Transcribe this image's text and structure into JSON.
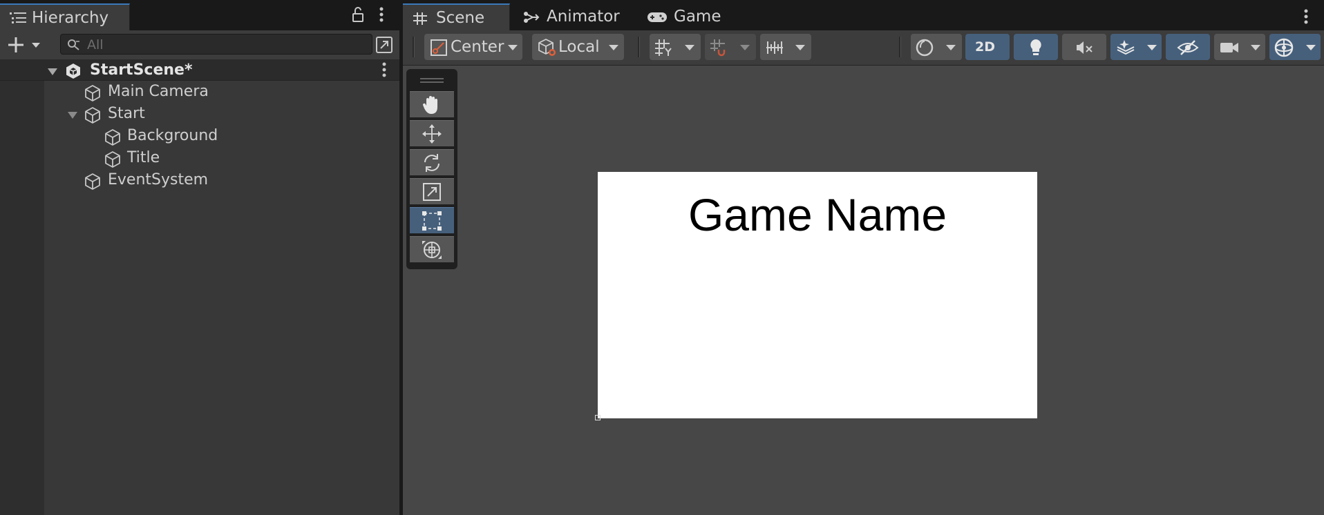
{
  "hierarchy": {
    "tab_label": "Hierarchy",
    "search_placeholder": "All",
    "scene_name": "StartScene*",
    "items": [
      {
        "label": "Main Camera"
      },
      {
        "label": "Start"
      },
      {
        "label": "Background"
      },
      {
        "label": "Title"
      },
      {
        "label": "EventSystem"
      }
    ]
  },
  "scene_view": {
    "tabs": [
      {
        "label": "Scene",
        "icon": "grid-hash-icon"
      },
      {
        "label": "Animator",
        "icon": "animator-icon"
      },
      {
        "label": "Game",
        "icon": "gamepad-icon"
      }
    ],
    "toolbar": {
      "pivot_mode": "Center",
      "pivot_rotation": "Local",
      "mode_2d": "2D"
    },
    "canvas_text": "Game Name"
  },
  "colors": {
    "accent_blue": "#46607c",
    "tab_highlight": "#3a79bb",
    "panel_bg": "#383838",
    "scene_bg": "#474747"
  }
}
